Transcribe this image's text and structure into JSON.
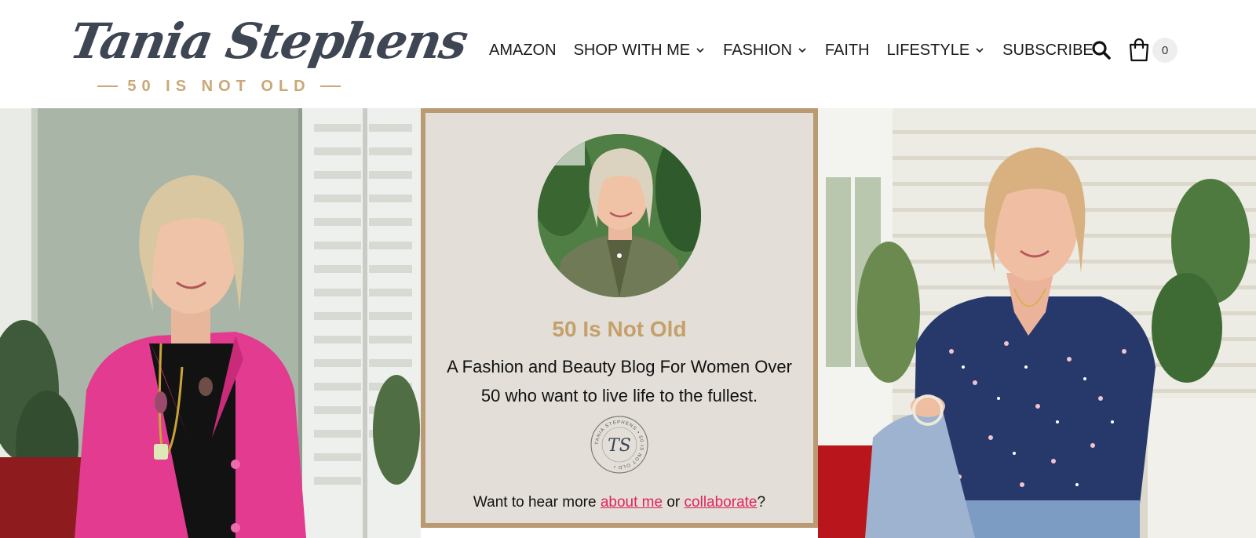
{
  "header": {
    "logo_name": "Tania Stephens",
    "logo_tagline": "50 IS NOT OLD",
    "nav": [
      {
        "label": "AMAZON",
        "has_dropdown": false
      },
      {
        "label": "SHOP WITH ME",
        "has_dropdown": true
      },
      {
        "label": "FASHION",
        "has_dropdown": true
      },
      {
        "label": "FAITH",
        "has_dropdown": false
      },
      {
        "label": "LIFESTYLE",
        "has_dropdown": true
      },
      {
        "label": "SUBSCRIBE",
        "has_dropdown": false
      }
    ],
    "search_icon": "search-icon",
    "cart_icon": "shopping-bag-icon",
    "cart_count": "0"
  },
  "hero": {
    "left_photo": "photo-woman-pink-blazer",
    "right_photo": "photo-woman-floral-top",
    "card": {
      "avatar": "photo-woman-green-jacket",
      "title": "50 Is Not Old",
      "description": "A Fashion and Beauty Blog For Women Over 50 who want to live life to the fullest.",
      "seal_monogram": "TS",
      "seal_ring_text": "TANIA STEPHENS • 50 IS NOT OLD •",
      "cta_prefix": "Want to hear more ",
      "cta_link1": "about me",
      "cta_middle": " or ",
      "cta_link2": "collaborate",
      "cta_suffix": "?"
    }
  },
  "colors": {
    "accent_gold": "#c4a06b",
    "card_border": "#b99a72",
    "card_bg": "#e3dfd8",
    "link": "#e0245e",
    "logo_text": "#3e4654"
  }
}
